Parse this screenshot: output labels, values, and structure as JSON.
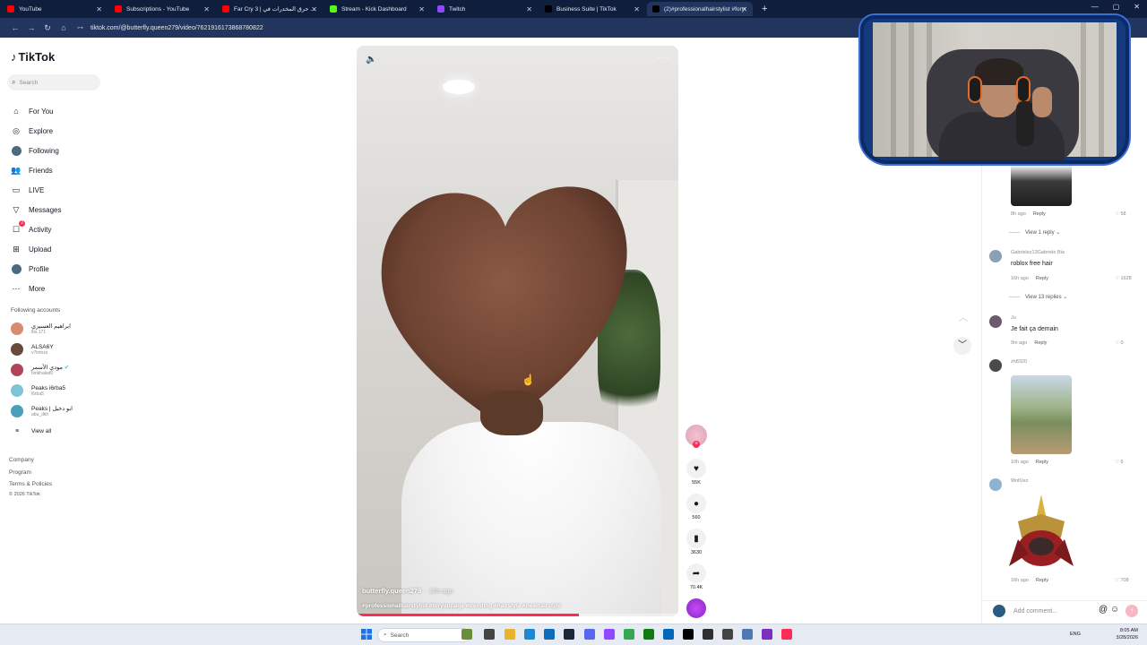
{
  "browser": {
    "tabs": [
      {
        "title": "YouTube",
        "color": "#ff0000",
        "active": false
      },
      {
        "title": "Subscriptions - YouTube",
        "color": "#ff0000",
        "active": false
      },
      {
        "title": "Far Cry 3 | حرق المخدرات في ...",
        "color": "#ff0000",
        "active": false
      },
      {
        "title": "Stream - Kick Dashboard",
        "color": "#53fc18",
        "active": false
      },
      {
        "title": "Twitch",
        "color": "#9146ff",
        "active": false
      },
      {
        "title": "Business Suite | TikTok",
        "color": "#000000",
        "active": false
      },
      {
        "title": "(2)#professionalhairstylist #foryo",
        "color": "#000000",
        "active": true
      }
    ],
    "url": "tiktok.com/@butterfly.queen279/video/7621916173868780822"
  },
  "sidebar": {
    "logo": "TikTok",
    "search_placeholder": "Search",
    "nav": [
      {
        "label": "For You",
        "icon": "home-icon",
        "glyph": "⌂"
      },
      {
        "label": "Explore",
        "icon": "compass-icon",
        "glyph": "◎"
      },
      {
        "label": "Following",
        "icon": "following-avatar-icon",
        "glyph": ""
      },
      {
        "label": "Friends",
        "icon": "friends-icon",
        "glyph": "👥"
      },
      {
        "label": "LIVE",
        "icon": "live-icon",
        "glyph": "▭"
      },
      {
        "label": "Messages",
        "icon": "messages-icon",
        "glyph": "▽"
      },
      {
        "label": "Activity",
        "icon": "activity-icon",
        "glyph": "☐"
      },
      {
        "label": "Upload",
        "icon": "upload-icon",
        "glyph": "⊞"
      },
      {
        "label": "Profile",
        "icon": "profile-avatar-icon",
        "glyph": ""
      },
      {
        "label": "More",
        "icon": "more-icon",
        "glyph": "⋯"
      }
    ],
    "activity_badge": "2",
    "following_title": "Following accounts",
    "accounts": [
      {
        "name": "ابراهيم العسيري",
        "handle": "ibs.171",
        "color": "#d98a70"
      },
      {
        "name": "ALSA6Y",
        "handle": "v7imnss",
        "color": "#6a4a3a"
      },
      {
        "name": "مودي الأسمر",
        "handle": "binkhaled0",
        "color": "#b0455a",
        "verified": true
      },
      {
        "name": "Peaks i6rba5",
        "handle": "i6rba5",
        "color": "#7fc4d6"
      },
      {
        "name": "Peaks | ابو دخيل",
        "handle": "abu_dkh",
        "color": "#4aa0b8"
      }
    ],
    "view_all": "View all",
    "footer": [
      "Company",
      "Program",
      "Terms & Policies"
    ],
    "copyright": "© 2026 TikTok"
  },
  "video": {
    "author": "butterfly.queen279",
    "posted": "· 16h ago",
    "caption": "#professionalhairstylist #foryoupage #trending #hairstyle #newhairstyle",
    "progress": 0.69
  },
  "actions": {
    "likes": "55K",
    "comments": "560",
    "saves": "3630",
    "shares": "70.4K"
  },
  "comments": [
    {
      "type": "media-tail",
      "time": "8h ago",
      "reply": "Reply",
      "likes": "58",
      "view_replies": "View 1 reply"
    },
    {
      "user": "Gabrielez13Gabriele Bia",
      "text": "roblox free hair",
      "time": "16h ago",
      "reply": "Reply",
      "likes": "1628",
      "view_replies": "View 13 replies",
      "avatar": "#8aa0b5"
    },
    {
      "user": "Ju",
      "text": "Je fait ça demain",
      "time": "9m ago",
      "reply": "Reply",
      "likes": "0",
      "avatar": "#6a5a6a"
    },
    {
      "user": "zh8320",
      "text": "",
      "time": "10h ago",
      "reply": "Reply",
      "likes": "6",
      "avatar": "#4a4a4a"
    },
    {
      "user": "WolfJez",
      "text": "",
      "time": "16h ago",
      "reply": "Reply",
      "likes": "708",
      "avatar": "#8fb2d0"
    }
  ],
  "add_comment_placeholder": "Add comment...",
  "taskbar": {
    "search": "Search",
    "lang": "ENG",
    "time": "8:05 AM",
    "date": "3/28/2026"
  }
}
